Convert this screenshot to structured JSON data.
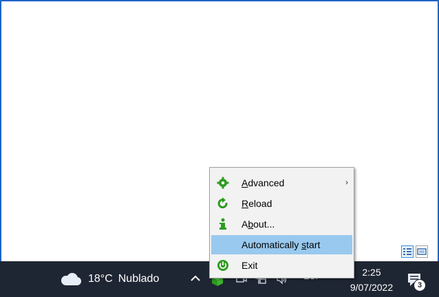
{
  "desktop": {
    "view_switch": [
      "details-view-icon",
      "preview-view-icon"
    ]
  },
  "taskbar": {
    "weather": {
      "temperature": "18°C",
      "condition": "Nublado"
    },
    "language": "ESP",
    "clock": {
      "time": "2:25",
      "date": "9/07/2022"
    },
    "notifications_count": "3"
  },
  "context_menu": {
    "items": [
      {
        "pre": "",
        "mnemonic": "A",
        "post": "dvanced",
        "icon": "gear-icon",
        "submenu": true,
        "icon_color": "#2e9b1f"
      },
      {
        "pre": "",
        "mnemonic": "R",
        "post": "eload",
        "icon": "reload-icon",
        "submenu": false,
        "icon_color": "#2e9b1f"
      },
      {
        "pre": "A",
        "mnemonic": "b",
        "post": "out...",
        "icon": "info-icon",
        "submenu": false,
        "icon_color": "#2e9b1f"
      },
      {
        "pre": "Automatically ",
        "mnemonic": "s",
        "post": "tart",
        "icon": "",
        "submenu": false,
        "highlighted": true
      },
      {
        "pre": "E",
        "mnemonic": "",
        "post": "xit",
        "icon": "power-icon",
        "submenu": false,
        "icon_color": "#2e9b1f"
      }
    ],
    "highlight_color": "#99c9ef"
  }
}
